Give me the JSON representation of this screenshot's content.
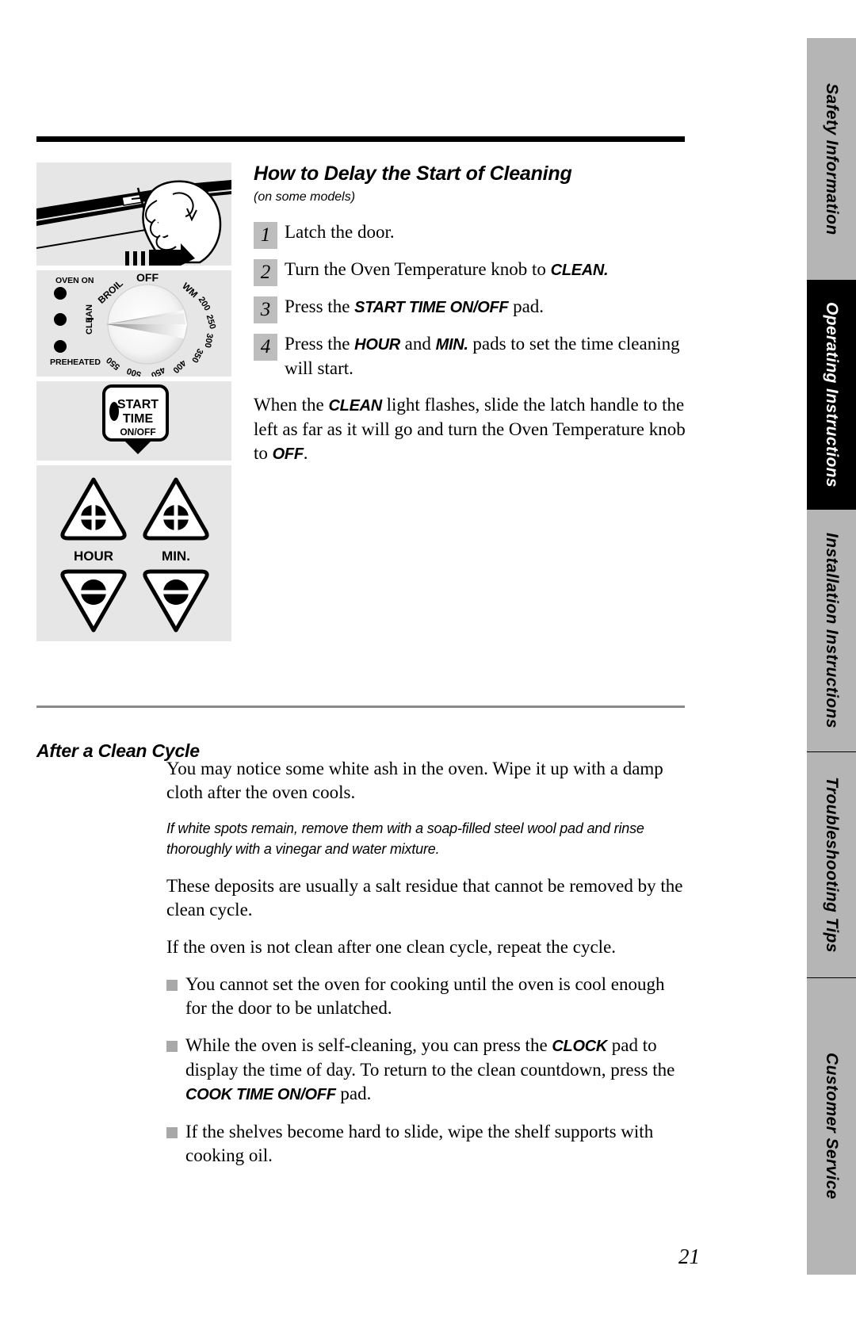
{
  "page": {
    "number": "21"
  },
  "tabs": [
    {
      "label": "Safety Information",
      "active": false,
      "flex": 305
    },
    {
      "label": "Operating Instructions",
      "active": true,
      "flex": 290
    },
    {
      "label": "Installation Instructions",
      "active": false,
      "flex": 305
    },
    {
      "label": "Troubleshooting Tips",
      "active": false,
      "flex": 285
    },
    {
      "label": "Customer Service",
      "active": false,
      "flex": 375
    }
  ],
  "section": {
    "title": "How to Delay the Start of Cleaning",
    "subtitle": "(on some models)",
    "steps": [
      {
        "num": "1",
        "before": "Latch the door.",
        "pad": "",
        "after": ""
      },
      {
        "num": "2",
        "before": "Turn the Oven Temperature knob to ",
        "pad": "CLEAN.",
        "after": ""
      },
      {
        "num": "3",
        "before": "Press the ",
        "pad": "START TIME ON/OFF",
        "after": " pad."
      },
      {
        "num": "4",
        "before": "Press the ",
        "pad": "HOUR",
        "mid": " and ",
        "pad2": "MIN.",
        "after": " pads to set the time cleaning will start."
      }
    ],
    "closing": {
      "before": "When the ",
      "pad": "CLEAN",
      "mid": " light flashes, slide the latch handle to the left as far as it will go and turn the Oven Temperature knob to ",
      "pad2": "OFF",
      "after": "."
    }
  },
  "figures": {
    "latch": {
      "caption": "hand sliding oven door latch handle"
    },
    "knob": {
      "dial_off": "OFF",
      "dial_labels": [
        "BROIL",
        "WM",
        "200",
        "250",
        "300",
        "350",
        "400",
        "450",
        "500",
        "550",
        "CLEAN"
      ],
      "indicator_labels": [
        "OVEN ON",
        "CLEAN",
        "PREHEATED"
      ]
    },
    "start_pad": {
      "line1": "START",
      "line2": "TIME",
      "line3": "ON/OFF"
    },
    "hour_min_pad": {
      "hour_label": "HOUR",
      "min_label": "MIN."
    }
  },
  "after_clean": {
    "heading": "After a Clean Cycle",
    "para1": "You may notice some white ash in the oven. Wipe it up with a damp cloth after the oven cools.",
    "note": "If white spots remain, remove them with a soap-filled steel wool pad and rinse thoroughly with a vinegar and water mixture.",
    "para2": "These deposits are usually a salt residue that cannot be removed by the clean cycle.",
    "para3": "If the oven is not clean after one clean cycle, repeat the cycle.",
    "bullets": [
      {
        "before": "You cannot set the oven for cooking until the oven is cool enough for the door to be unlatched.",
        "pad": "",
        "mid": "",
        "pad2": "",
        "after": ""
      },
      {
        "before": "While the oven is self-cleaning, you can press the ",
        "pad": "CLOCK",
        "mid": " pad to display the time of day. To return to the clean countdown, press the ",
        "pad2": "COOK TIME ON/OFF",
        "after": " pad."
      },
      {
        "before": "If the shelves become hard to slide, wipe the shelf supports with cooking oil.",
        "pad": "",
        "mid": "",
        "pad2": "",
        "after": ""
      }
    ]
  },
  "colors": {
    "tab_inactive": "#b5b5b5",
    "tab_active": "#000000",
    "figure_bg": "#e6e6e6",
    "step_num_bg": "#bdbdbd",
    "bullet": "#a8a8a8"
  }
}
